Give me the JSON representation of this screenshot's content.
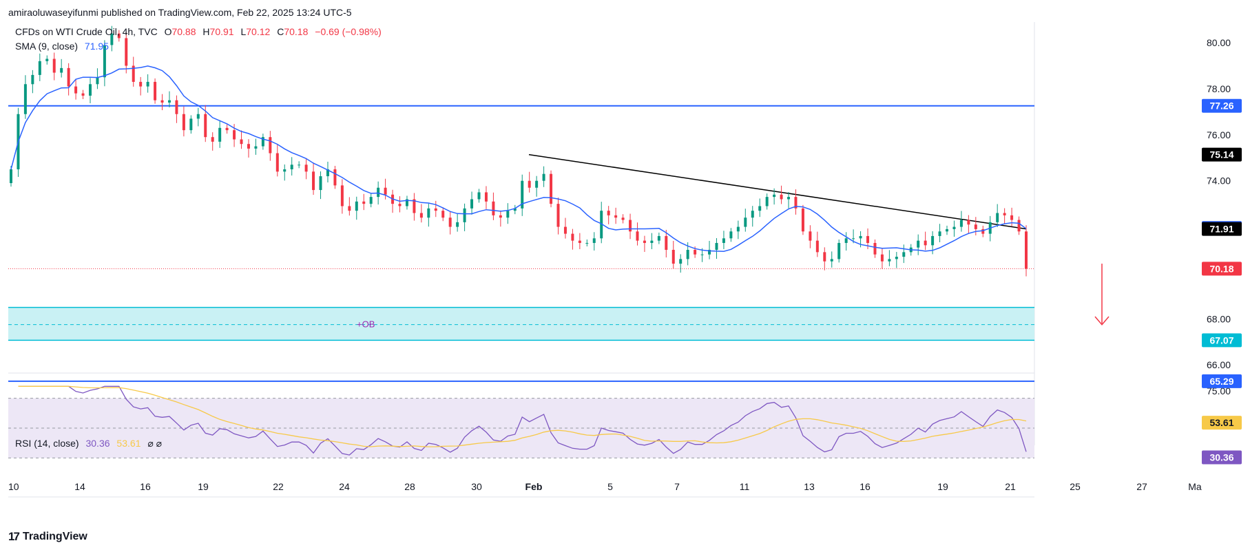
{
  "header": {
    "published_text": "amiraoluwaseyifunmi published on TradingView.com, Feb 22, 2025 13:24 UTC-5"
  },
  "legend": {
    "symbol": "CFDs on WTI Crude Oil, 4h, TVC",
    "o_label": "O",
    "o_value": "70.88",
    "h_label": "H",
    "h_value": "70.91",
    "l_label": "L",
    "l_value": "70.12",
    "c_label": "C",
    "c_value": "70.18",
    "change": "−0.69 (−0.98%)",
    "sma_label": "SMA (9, close)",
    "sma_value": "71.95",
    "rsi_label": "RSI (14, close)",
    "rsi_value": "30.36",
    "rsi_ma_value": "53.61",
    "rsi_extra": "⌀ ⌀"
  },
  "annotations": {
    "ob_label": "+OB"
  },
  "price_badges": [
    {
      "name": "resistance-77-26",
      "value": "77.26",
      "color": "#2962ff"
    },
    {
      "name": "trendline-start",
      "value": "75.14",
      "color": "#000000"
    },
    {
      "name": "sma-value",
      "value": "71.95",
      "color": "#2962ff"
    },
    {
      "name": "trendline-end",
      "value": "71.91",
      "color": "#000000"
    },
    {
      "name": "last-price",
      "value": "70.18",
      "color": "#f23645"
    },
    {
      "name": "ob-lower",
      "value": "67.07",
      "color": "#00bcd4"
    },
    {
      "name": "support-65-29",
      "value": "65.29",
      "color": "#2962ff"
    }
  ],
  "rsi_badges": [
    {
      "name": "rsi-ma",
      "value": "53.61",
      "color": "#f7c948"
    },
    {
      "name": "rsi-value",
      "value": "30.36",
      "color": "#7e57c2"
    }
  ],
  "colors": {
    "up": "#089981",
    "down": "#f23645",
    "sma": "#2962ff",
    "level": "#2962ff",
    "ob_fill": "#c9f1f4",
    "ob_line": "#00bcd4",
    "rsi": "#7e57c2",
    "rsi_ma": "#f7c948",
    "rsi_band": "#ede7f6",
    "trend": "#000000",
    "arrow": "#f23645"
  },
  "footer": {
    "brand": "TradingView"
  },
  "chart_data": {
    "type": "candlestick",
    "title": "CFDs on WTI Crude Oil, 4h, TVC",
    "ylim": [
      64.6,
      80.9
    ],
    "y_ticks": [
      "80.00",
      "78.00",
      "76.00",
      "74.00",
      "68.00",
      "66.00"
    ],
    "x_ticks": [
      "10",
      "14",
      "16",
      "19",
      "22",
      "24",
      "28",
      "30",
      "Feb",
      "5",
      "7",
      "11",
      "13",
      "16",
      "19",
      "21",
      "25",
      "27",
      "Ma"
    ],
    "levels": [
      {
        "name": "resistance",
        "price": 77.26
      },
      {
        "name": "support",
        "price": 65.29
      },
      {
        "name": "ob_upper",
        "price": 68.5
      },
      {
        "name": "ob_lower",
        "price": 67.07
      },
      {
        "name": "ob_mid",
        "price": 67.75
      },
      {
        "name": "last_price",
        "price": 70.18
      }
    ],
    "trendline": {
      "from": 75.14,
      "to": 71.91
    },
    "closes": [
      74.5,
      76.9,
      78.2,
      78.6,
      79.2,
      79.3,
      78.7,
      78.9,
      78.1,
      77.8,
      77.7,
      78.2,
      78.5,
      79.9,
      80.4,
      80.2,
      79.0,
      78.3,
      78.1,
      78.3,
      77.5,
      77.4,
      77.5,
      76.9,
      76.2,
      76.7,
      76.9,
      75.9,
      75.7,
      76.3,
      76.2,
      75.8,
      75.6,
      75.4,
      75.5,
      75.9,
      75.2,
      74.4,
      74.5,
      74.7,
      74.7,
      74.4,
      73.6,
      74.2,
      74.5,
      73.8,
      72.9,
      72.7,
      73.1,
      73.0,
      73.3,
      73.7,
      73.4,
      73.0,
      72.9,
      73.2,
      72.6,
      72.4,
      72.8,
      72.7,
      72.4,
      72.0,
      72.2,
      72.8,
      73.2,
      73.5,
      73.1,
      72.5,
      72.4,
      72.7,
      72.8,
      74.0,
      73.7,
      74.0,
      74.3,
      73.0,
      72.0,
      71.7,
      71.4,
      71.3,
      71.3,
      71.5,
      72.7,
      72.5,
      72.4,
      72.3,
      71.8,
      71.4,
      71.3,
      71.4,
      71.6,
      71.0,
      70.4,
      70.6,
      71.0,
      70.8,
      70.8,
      71.0,
      71.3,
      71.5,
      71.8,
      72.0,
      72.4,
      72.7,
      72.9,
      73.3,
      73.4,
      73.2,
      73.3,
      72.8,
      71.8,
      71.4,
      70.9,
      70.5,
      70.6,
      71.3,
      71.5,
      71.5,
      71.6,
      71.3,
      70.8,
      70.5,
      70.6,
      70.7,
      70.9,
      71.1,
      71.4,
      71.2,
      71.6,
      71.8,
      71.9,
      72.0,
      72.3,
      72.1,
      71.9,
      71.7,
      72.2,
      72.6,
      72.5,
      72.3,
      71.8,
      70.18
    ],
    "rsi": {
      "series": [
        {
          "name": "RSI (14, close)",
          "last": 30.36
        },
        {
          "name": "RSI MA",
          "last": 53.61
        }
      ],
      "ylim": [
        20,
        80
      ],
      "ticks": [
        "75.00"
      ],
      "bands": [
        70,
        30
      ]
    }
  }
}
